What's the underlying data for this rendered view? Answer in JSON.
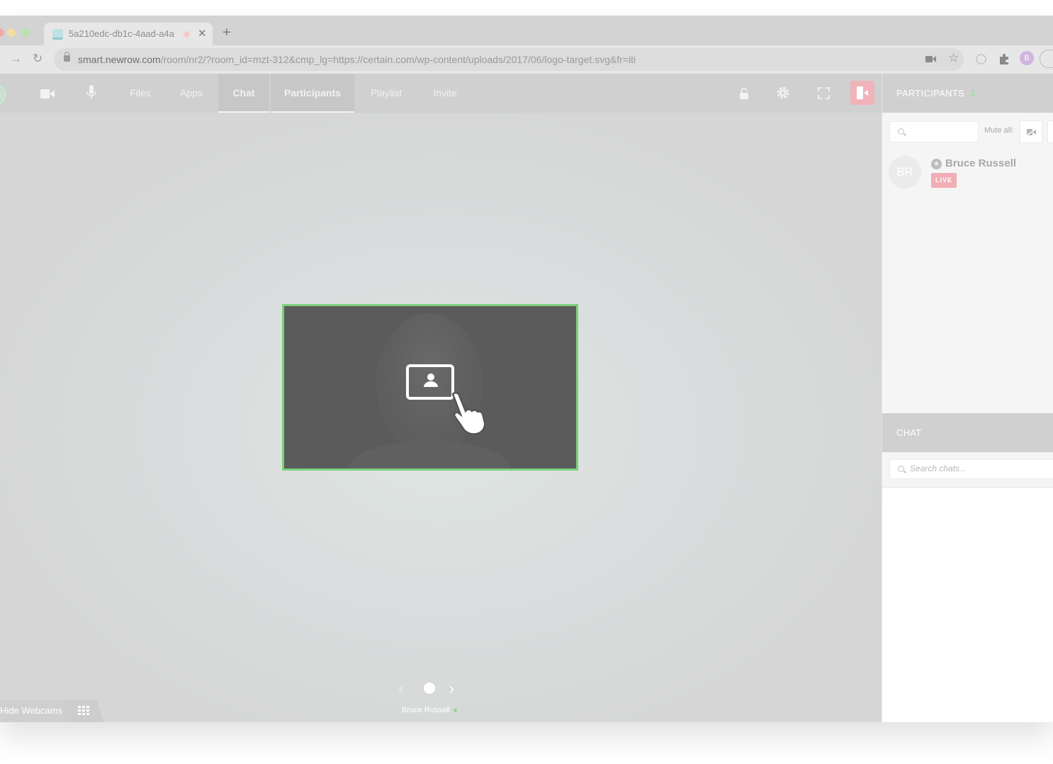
{
  "browser": {
    "tab_title": "5a210edc-db1c-4aad-a4a",
    "tab_close": "✕",
    "new_tab": "+",
    "url_host": "smart.newrow.com",
    "url_path": "/room/nr2/?room_id=mzt-312&cmp_lg=https://certain.com/wp-content/uploads/2017/06/logo-target.svg&fr=iti",
    "profile_initial": "B"
  },
  "appnav": {
    "items": [
      {
        "label": "Files"
      },
      {
        "label": "Apps"
      },
      {
        "label": "Chat"
      },
      {
        "label": "Participants"
      },
      {
        "label": "Playlist"
      },
      {
        "label": "Invite"
      }
    ]
  },
  "stage": {
    "hide_webcams_label": "Hide Webcams",
    "presenter_name": "Bruce Russell",
    "pager_prev": "‹",
    "pager_next": "›"
  },
  "participants": {
    "header": "PARTICIPANTS",
    "count": "1",
    "mute_all_label": "Mute all:",
    "list": [
      {
        "initials": "BR",
        "name": "Bruce Russell",
        "badge": "LIVE"
      }
    ]
  },
  "chat": {
    "header": "CHAT",
    "search_placeholder": "Search chats..."
  },
  "colors": {
    "accent_green": "#7ad07a",
    "leave_red": "#f0b3b9",
    "live_badge": "#f1aeb5"
  }
}
